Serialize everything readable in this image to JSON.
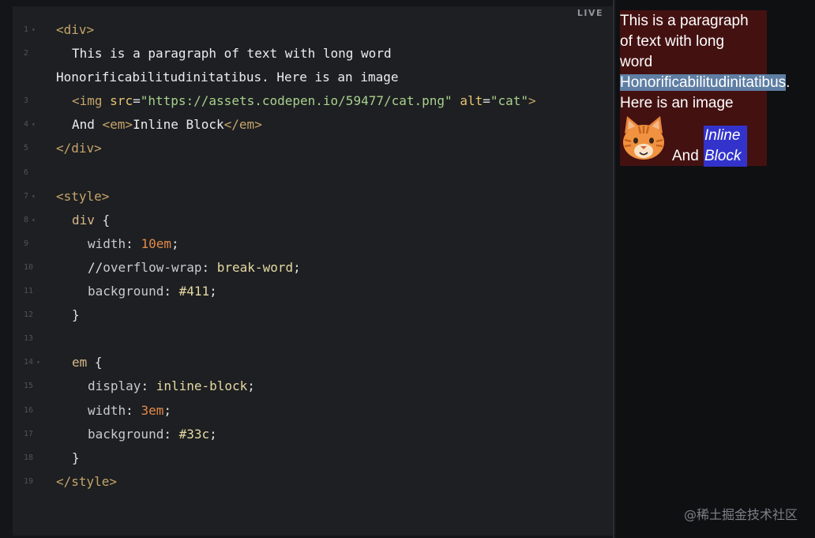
{
  "editor": {
    "live_label": "LIVE",
    "lines": [
      {
        "num": "1",
        "fold": true,
        "tokens": [
          {
            "t": "<div>",
            "c": "tag"
          }
        ]
      },
      {
        "num": "2",
        "fold": false,
        "indent": 1,
        "tokens": [
          {
            "t": "This is a paragraph of text with long word",
            "c": "text"
          }
        ]
      },
      {
        "num": "",
        "fold": false,
        "tokens": [
          {
            "t": "Honorificabilitudinitatibus. Here is an image",
            "c": "text"
          }
        ]
      },
      {
        "num": "3",
        "fold": false,
        "indent": 1,
        "tokens": [
          {
            "t": "<img ",
            "c": "tag"
          },
          {
            "t": "src",
            "c": "attr"
          },
          {
            "t": "=",
            "c": "punct"
          },
          {
            "t": "\"https://assets.codepen.io/59477/cat.png\"",
            "c": "str"
          },
          {
            "t": " ",
            "c": "text"
          },
          {
            "t": "alt",
            "c": "attr"
          },
          {
            "t": "=",
            "c": "punct"
          },
          {
            "t": "\"cat\"",
            "c": "str"
          },
          {
            "t": ">",
            "c": "tag"
          }
        ]
      },
      {
        "num": "4",
        "fold": true,
        "indent": 1,
        "tokens": [
          {
            "t": "And ",
            "c": "text"
          },
          {
            "t": "<em>",
            "c": "tag"
          },
          {
            "t": "Inline Block",
            "c": "text"
          },
          {
            "t": "</em>",
            "c": "tag"
          }
        ]
      },
      {
        "num": "5",
        "fold": false,
        "tokens": [
          {
            "t": "</div>",
            "c": "tag"
          }
        ]
      },
      {
        "num": "6",
        "fold": false,
        "tokens": []
      },
      {
        "num": "7",
        "fold": true,
        "tokens": [
          {
            "t": "<style>",
            "c": "tag"
          }
        ]
      },
      {
        "num": "8",
        "fold": true,
        "indent": 1,
        "tokens": [
          {
            "t": "div",
            "c": "sel"
          },
          {
            "t": " {",
            "c": "punct"
          }
        ]
      },
      {
        "num": "9",
        "fold": false,
        "indent": 2,
        "tokens": [
          {
            "t": "width",
            "c": "prop"
          },
          {
            "t": ": ",
            "c": "punct"
          },
          {
            "t": "10em",
            "c": "num"
          },
          {
            "t": ";",
            "c": "punct"
          }
        ]
      },
      {
        "num": "10",
        "fold": false,
        "indent": 2,
        "tokens": [
          {
            "t": "//",
            "c": "punct"
          },
          {
            "t": "overflow-wrap",
            "c": "prop"
          },
          {
            "t": ": ",
            "c": "punct"
          },
          {
            "t": "break-word",
            "c": "val"
          },
          {
            "t": ";",
            "c": "punct"
          }
        ]
      },
      {
        "num": "11",
        "fold": false,
        "indent": 2,
        "tokens": [
          {
            "t": "background",
            "c": "prop"
          },
          {
            "t": ": ",
            "c": "punct"
          },
          {
            "t": "#411",
            "c": "val"
          },
          {
            "t": ";",
            "c": "punct"
          }
        ]
      },
      {
        "num": "12",
        "fold": false,
        "indent": 1,
        "tokens": [
          {
            "t": "}",
            "c": "punct"
          }
        ]
      },
      {
        "num": "13",
        "fold": false,
        "tokens": []
      },
      {
        "num": "14",
        "fold": true,
        "indent": 1,
        "tokens": [
          {
            "t": "em",
            "c": "sel"
          },
          {
            "t": " {",
            "c": "punct"
          }
        ]
      },
      {
        "num": "15",
        "fold": false,
        "indent": 2,
        "tokens": [
          {
            "t": "display",
            "c": "prop"
          },
          {
            "t": ": ",
            "c": "punct"
          },
          {
            "t": "inline-block",
            "c": "val"
          },
          {
            "t": ";",
            "c": "punct"
          }
        ]
      },
      {
        "num": "16",
        "fold": false,
        "indent": 2,
        "tokens": [
          {
            "t": "width",
            "c": "prop"
          },
          {
            "t": ": ",
            "c": "punct"
          },
          {
            "t": "3em",
            "c": "num"
          },
          {
            "t": ";",
            "c": "punct"
          }
        ]
      },
      {
        "num": "17",
        "fold": false,
        "indent": 2,
        "tokens": [
          {
            "t": "background",
            "c": "prop"
          },
          {
            "t": ": ",
            "c": "punct"
          },
          {
            "t": "#33c",
            "c": "val"
          },
          {
            "t": ";",
            "c": "punct"
          }
        ]
      },
      {
        "num": "18",
        "fold": false,
        "indent": 1,
        "tokens": [
          {
            "t": "}",
            "c": "punct"
          }
        ]
      },
      {
        "num": "19",
        "fold": false,
        "tokens": [
          {
            "t": "</style>",
            "c": "tag"
          }
        ]
      }
    ]
  },
  "preview": {
    "line1": "This is a paragraph",
    "line2": "of text with long",
    "line3": "word",
    "long_word": "Honorificabilitudinitatibus",
    "after_long": ".",
    "line5": "Here is an image",
    "and_text": "And",
    "em_line1": "Inline",
    "em_line2": "Block",
    "cat_icon": "cat-face-icon",
    "colors": {
      "div_bg": "#441111",
      "em_bg": "#3333cc",
      "selection": "#5e7ea3"
    }
  },
  "watermark": "@稀土掘金技术社区"
}
